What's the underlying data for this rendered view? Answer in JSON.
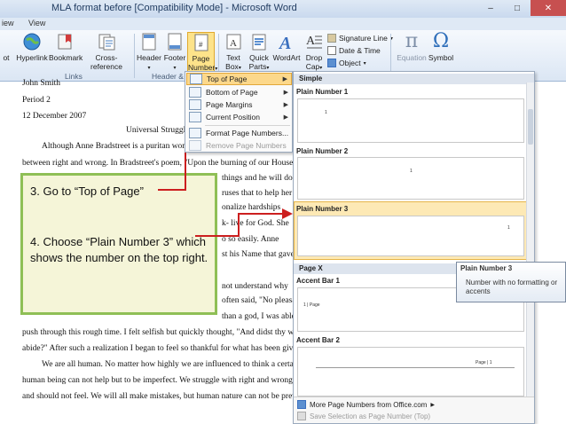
{
  "window": {
    "tab_left": "iew",
    "tab_view": "View",
    "title": "MLA format before [Compatibility Mode] - Microsoft Word",
    "minimize": "–",
    "maximize": "□",
    "close": "✕"
  },
  "ribbon": {
    "cut_label": "ot",
    "hyperlink": "Hyperlink",
    "bookmark": "Bookmark",
    "cross_reference": "Cross-reference",
    "header": "Header",
    "footer": "Footer",
    "page_number_1": "Page",
    "page_number_2": "Number",
    "text_box_1": "Text",
    "text_box_2": "Box",
    "quick_parts_1": "Quick",
    "quick_parts_2": "Parts",
    "wordart": "WordArt",
    "drop_cap_1": "Drop",
    "drop_cap_2": "Cap",
    "signature_line": "Signature Line",
    "date_time": "Date & Time",
    "object": "Object",
    "equation": "Equation",
    "symbol": "Symbol",
    "group_links": "Links",
    "group_header_footer": "Header & F"
  },
  "document": {
    "lines": [
      "John Smith",
      "Period 2",
      "12 December 2007",
      "Universal Struggles",
      "Although Anne Bradstreet is a puritan woman, she is",
      "between right and wrong. In Bradstreet's poem, \"Upon the burning of our House\" she finds it",
      "things and he will do",
      "ruses that to help her",
      "onalize hardships",
      "k- live for God. She",
      "o so easily. Anne",
      "st his Name that gave",
      "not understand why",
      "often said, \"No pleasant",
      "than a god, I was able to",
      "push through this rough time. I felt selfish but quickly thought, \"And didst thy wealth on earth",
      "abide?\" After such a realization I began to feel so thankful for what has been given to me.",
      "We are all human. No matter how highly we are influenced to think a certain way, a",
      "human being can not help but to be imperfect. We struggle with right and wrong, how we should",
      "and should not feel. We will all make mistakes, but human nature can not be prevented."
    ]
  },
  "callout": {
    "step3": "3. Go to “Top of Page”",
    "step4": "4. Choose “Plain Number 3” which shows the number on the top right."
  },
  "menu": {
    "items": [
      "Top of Page",
      "Bottom of Page",
      "Page Margins",
      "Current Position",
      "Format Page Numbers...",
      "Remove Page Numbers"
    ]
  },
  "gallery": {
    "simple_header": "Simple",
    "plain1": "Plain Number 1",
    "plain2": "Plain Number 2",
    "plain3": "Plain Number 3",
    "pagex_header": "Page X",
    "accent1": "Accent Bar 1",
    "accent2": "Accent Bar 2",
    "thumb_num": "1",
    "accent1_text": "1 | Page",
    "accent2_text": "Page | 1",
    "more": "More Page Numbers from Office.com",
    "save": "Save Selection as Page Number (Top)"
  },
  "tooltip": {
    "title": "Plain Number 3",
    "desc": "Number with no formatting or accents"
  },
  "colors": {
    "accent_highlight": "#fde38a",
    "callout_border": "#8fbf56",
    "callout_bg": "#f5f5d8",
    "arrow": "#cc1f1f"
  }
}
